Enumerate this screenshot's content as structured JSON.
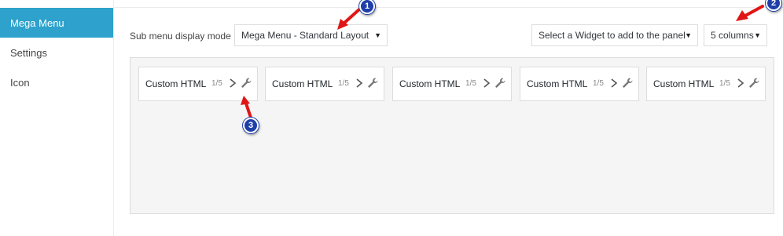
{
  "sidebar": {
    "items": [
      {
        "label": "Mega Menu"
      },
      {
        "label": "Settings"
      },
      {
        "label": "Icon"
      }
    ]
  },
  "toolbar": {
    "mode_label": "Sub menu display mode",
    "mode_select": "Mega Menu - Standard Layout",
    "widget_select": "Select a Widget to add to the panel",
    "columns_select": "5 columns"
  },
  "widgets": [
    {
      "title": "Custom HTML",
      "size": "1/5"
    },
    {
      "title": "Custom HTML",
      "size": "1/5"
    },
    {
      "title": "Custom HTML",
      "size": "1/5"
    },
    {
      "title": "Custom HTML",
      "size": "1/5"
    },
    {
      "title": "Custom HTML",
      "size": "1/5"
    }
  ],
  "annotations": {
    "marker1": "1",
    "marker2": "2",
    "marker3": "3"
  },
  "colors": {
    "accent": "#2ea2cc",
    "marker": "#1f3fa8",
    "arrow": "#e01616"
  }
}
